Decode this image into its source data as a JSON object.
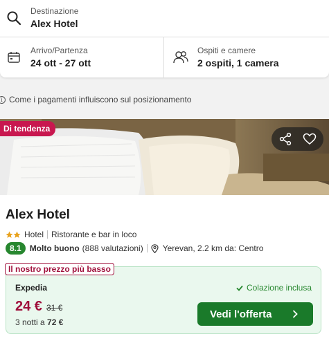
{
  "search": {
    "destination_label": "Destinazione",
    "destination_value": "Alex Hotel",
    "dates_label": "Arrivo/Partenza",
    "dates_value": "24 ott - 27 ott",
    "guests_label": "Ospiti e camere",
    "guests_value": "2 ospiti, 1 camera"
  },
  "info": {
    "text": "Come i pagamenti influiscono sul posizionamento"
  },
  "hotel": {
    "trend_badge": "Di tendenza",
    "name": "Alex Hotel",
    "star_count": 2,
    "type": "Hotel",
    "amenity": "Ristorante e bar in loco",
    "rating_score": "8.1",
    "rating_word": "Molto buono",
    "rating_count": "(888 valutazioni)",
    "location": "Yerevan, 2.2 km da: Centro"
  },
  "offer": {
    "lowest_badge": "Il nostro prezzo più basso",
    "provider": "Expedia",
    "breakfast": "Colazione inclusa",
    "price": "24 €",
    "old_price": "31 €",
    "nights_prefix": "3 notti a",
    "nights_total": "72 €",
    "cta_label": "Vedi l'offerta"
  },
  "colors": {
    "accent_red": "#c8174f",
    "price_red": "#a0103c",
    "green": "#27872f",
    "cta_green": "#1a7a2a",
    "offer_bg": "#eaf8ee",
    "star": "#e8a21c"
  },
  "icons": [
    "search-icon",
    "calendar-icon",
    "guests-icon",
    "info-icon",
    "share-icon",
    "heart-icon",
    "star-icon",
    "pin-icon",
    "check-icon",
    "chevron-right-icon"
  ]
}
